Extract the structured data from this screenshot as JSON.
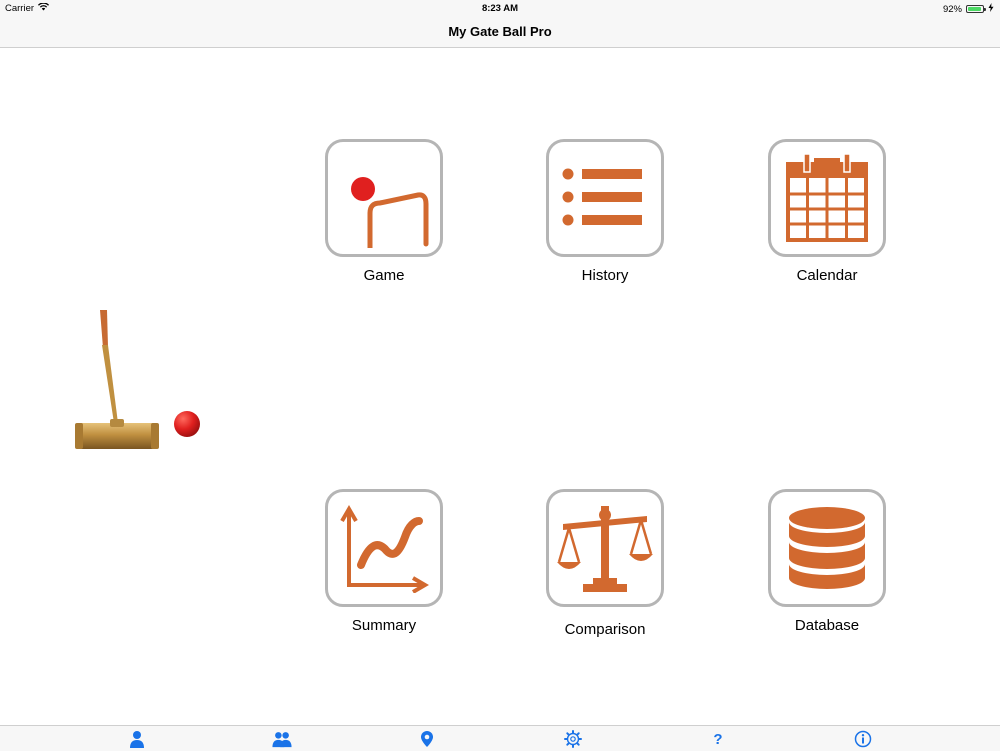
{
  "status_bar": {
    "carrier": "Carrier",
    "time": "8:23 AM",
    "battery": "92%",
    "battery_level": 0.92
  },
  "nav": {
    "title": "My Gate Ball Pro"
  },
  "tiles": [
    {
      "label": "Game",
      "icon": "gate-ball-icon"
    },
    {
      "label": "History",
      "icon": "list-icon"
    },
    {
      "label": "Calendar",
      "icon": "calendar-icon"
    },
    {
      "label": "Summary",
      "icon": "line-chart-icon"
    },
    {
      "label": "Comparison",
      "icon": "scales-icon"
    },
    {
      "label": "Database",
      "icon": "database-icon"
    }
  ],
  "tab_bar": {
    "items": [
      {
        "icon": "person-icon"
      },
      {
        "icon": "group-icon"
      },
      {
        "icon": "location-pin-icon"
      },
      {
        "icon": "gear-icon"
      },
      {
        "icon": "question-icon",
        "text": "?"
      },
      {
        "icon": "info-icon"
      }
    ]
  },
  "colors": {
    "accent": "#d2692f",
    "tile_border": "#b5b5b5",
    "ball": "#e0201f",
    "tab_icon": "#1a73e8"
  }
}
